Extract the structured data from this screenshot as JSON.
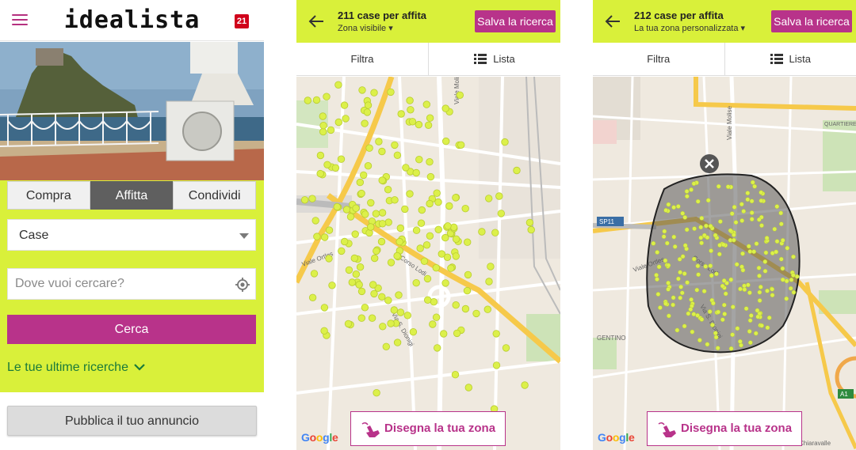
{
  "screen1": {
    "logo": "idealista",
    "notification_count": "21",
    "tabs": [
      {
        "label": "Compra",
        "active": false
      },
      {
        "label": "Affitta",
        "active": true
      },
      {
        "label": "Condividi",
        "active": false
      }
    ],
    "property_type": "Case",
    "search_placeholder": "Dove vuoi cercare?",
    "search_button": "Cerca",
    "recent_searches": "Le tue ultime ricerche",
    "publish_button": "Pubblica il tuo annuncio"
  },
  "screen2": {
    "title": "211 case per affita",
    "subtitle": "Zona visibile ▾",
    "save_button": "Salva la ricerca",
    "filter": "Filtra",
    "list": "Lista",
    "draw_button": "Disegna la tua zona",
    "map_labels": [
      "Corso Lodi",
      "Viale Ortles",
      "Via S. Dionigi",
      "Viale Molise"
    ]
  },
  "screen3": {
    "title": "212 case per affita",
    "subtitle": "La tua zona personalizzata ▾",
    "save_button": "Salva la ricerca",
    "filter": "Filtra",
    "list": "Lista",
    "draw_button": "Disegna la tua zona",
    "map_labels": [
      "QUARTIERE FORLANINI",
      "SP11",
      "GENTINO",
      "Chiaravalle",
      "Corso Lodi",
      "Viale Ortles",
      "Via S. Dionigi",
      "Viale Molise",
      "A1"
    ]
  },
  "google_attribution": "Google",
  "colors": {
    "accent_lime": "#d9f03a",
    "brand_magenta": "#b8338a",
    "marker_yellow": "#dcf04a",
    "map_background": "#efe9df",
    "road_yellow": "#f6c94a"
  }
}
